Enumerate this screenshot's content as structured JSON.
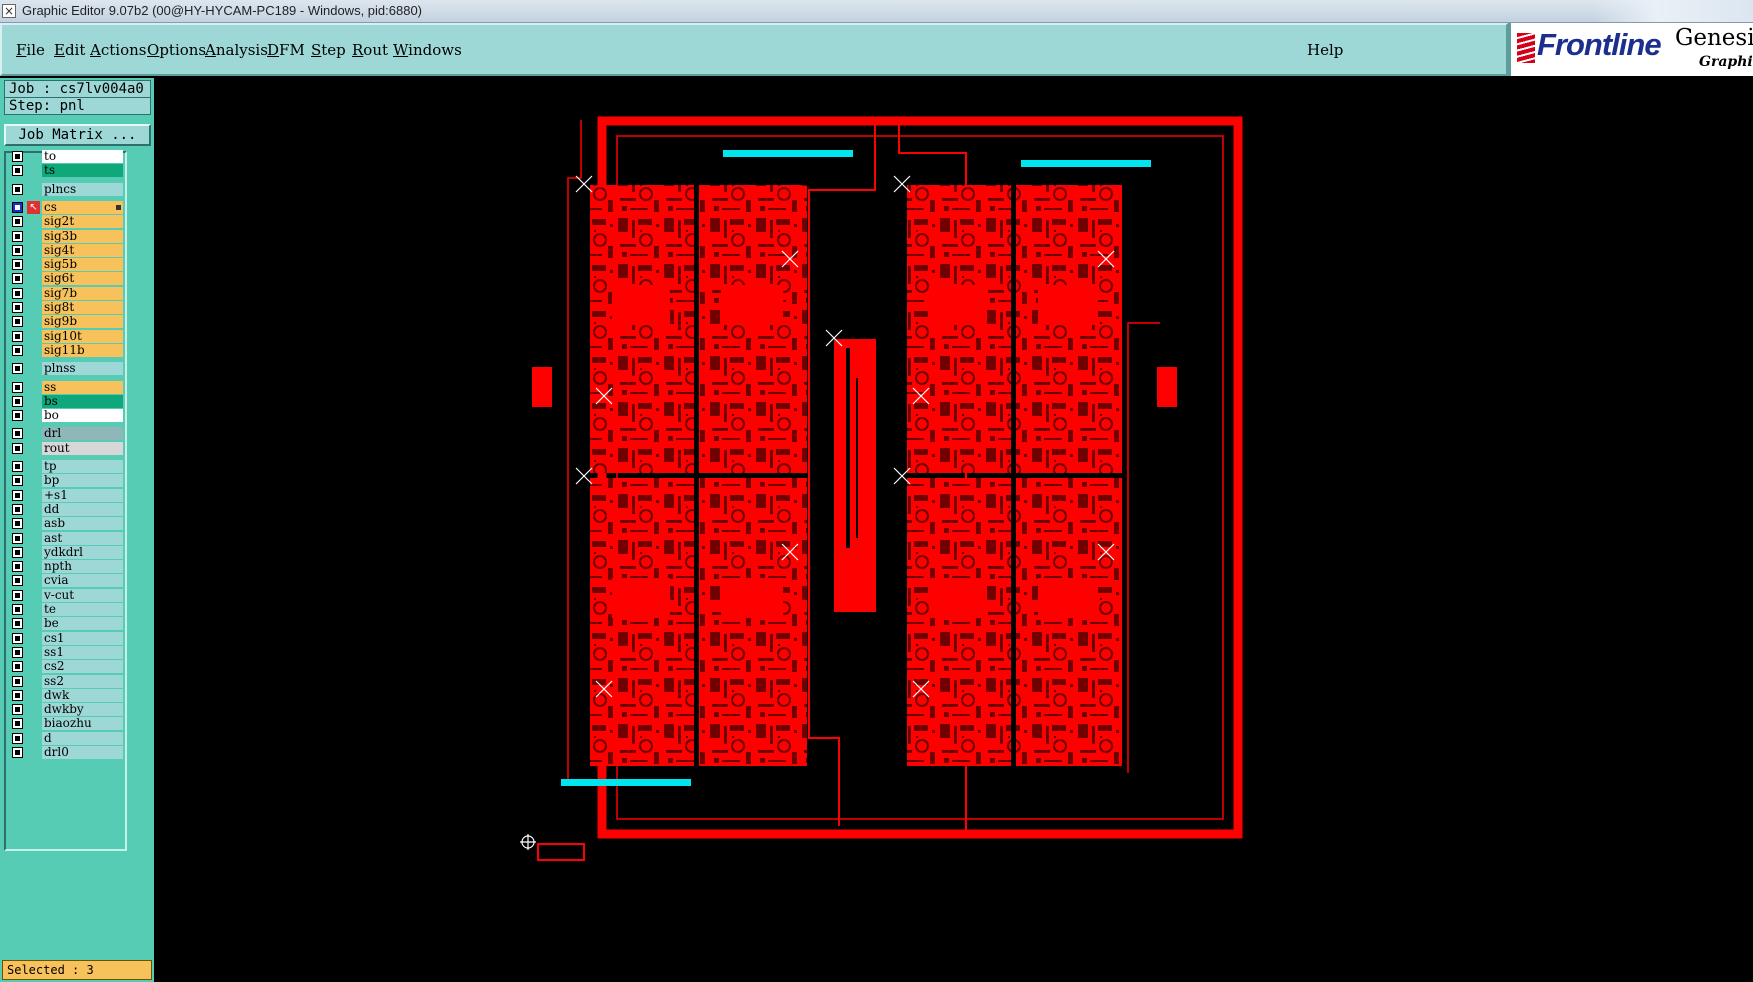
{
  "window": {
    "title": "Graphic Editor 9.07b2 (00@HY-HYCAM-PC189 - Windows, pid:6880)"
  },
  "menubar": {
    "items": [
      {
        "label": "File",
        "underline": "F",
        "rest": "ile"
      },
      {
        "label": "Edit",
        "underline": "E",
        "rest": "dit"
      },
      {
        "label": "Actions",
        "underline": "A",
        "rest": "ctions"
      },
      {
        "label": "Options",
        "underline": "O",
        "rest": "ptions"
      },
      {
        "label": "Analysis",
        "underline": "A",
        "rest": "nalysis"
      },
      {
        "label": "DFM",
        "underline": "D",
        "rest": "FM"
      },
      {
        "label": "Step",
        "underline": "S",
        "rest": "tep"
      },
      {
        "label": "Rout",
        "underline": "R",
        "rest": "out"
      },
      {
        "label": "Windows",
        "underline": "W",
        "rest": "indows"
      }
    ],
    "help": "Help"
  },
  "logo": {
    "brand": "Frontline",
    "product": "Genesis",
    "subtitle": "Graphic"
  },
  "job": {
    "job_line": "Job : cs7lv004a0",
    "step_line": "Step: pnl",
    "matrix_button": "Job Matrix ..."
  },
  "colors": {
    "board": "#ff0000",
    "highlight": "#00e5ee",
    "panel": "#56ccb4",
    "menu": "#9dd7d6"
  },
  "layers": [
    {
      "name": "to",
      "bg": "#ffffff",
      "group": 0
    },
    {
      "name": "ts",
      "bg": "#10a87a",
      "group": 0
    },
    {
      "name": "plncs",
      "bg": "#9dd7d6",
      "group": 1
    },
    {
      "name": "cs",
      "bg": "#f7c25b",
      "group": 2,
      "active": true
    },
    {
      "name": "sig2t",
      "bg": "#f7c25b",
      "group": 2
    },
    {
      "name": "sig3b",
      "bg": "#f7c25b",
      "group": 2
    },
    {
      "name": "sig4t",
      "bg": "#f7c25b",
      "group": 2
    },
    {
      "name": "sig5b",
      "bg": "#f7c25b",
      "group": 2
    },
    {
      "name": "sig6t",
      "bg": "#f7c25b",
      "group": 2
    },
    {
      "name": "sig7b",
      "bg": "#f7c25b",
      "group": 2
    },
    {
      "name": "sig8t",
      "bg": "#f7c25b",
      "group": 2
    },
    {
      "name": "sig9b",
      "bg": "#f7c25b",
      "group": 2
    },
    {
      "name": "sig10t",
      "bg": "#f7c25b",
      "group": 2
    },
    {
      "name": "sig11b",
      "bg": "#f7c25b",
      "group": 2
    },
    {
      "name": "plnss",
      "bg": "#9dd7d6",
      "group": 3
    },
    {
      "name": "ss",
      "bg": "#f7c25b",
      "group": 4
    },
    {
      "name": "bs",
      "bg": "#10a87a",
      "group": 4
    },
    {
      "name": "bo",
      "bg": "#ffffff",
      "group": 4
    },
    {
      "name": "drl",
      "bg": "#8fb6b8",
      "group": 5
    },
    {
      "name": "rout",
      "bg": "#d7d7d7",
      "group": 5
    },
    {
      "name": "tp",
      "bg": "#9dd7d6",
      "group": 6
    },
    {
      "name": "bp",
      "bg": "#9dd7d6",
      "group": 6
    },
    {
      "name": "+s1",
      "bg": "#9dd7d6",
      "group": 6
    },
    {
      "name": "dd",
      "bg": "#9dd7d6",
      "group": 6
    },
    {
      "name": "asb",
      "bg": "#9dd7d6",
      "group": 6
    },
    {
      "name": "ast",
      "bg": "#9dd7d6",
      "group": 6
    },
    {
      "name": "ydkdrl",
      "bg": "#9dd7d6",
      "group": 6
    },
    {
      "name": "npth",
      "bg": "#9dd7d6",
      "group": 6
    },
    {
      "name": "cvia",
      "bg": "#9dd7d6",
      "group": 6
    },
    {
      "name": "v-cut",
      "bg": "#9dd7d6",
      "group": 6
    },
    {
      "name": "te",
      "bg": "#9dd7d6",
      "group": 6
    },
    {
      "name": "be",
      "bg": "#9dd7d6",
      "group": 6
    },
    {
      "name": "cs1",
      "bg": "#9dd7d6",
      "group": 6
    },
    {
      "name": "ss1",
      "bg": "#9dd7d6",
      "group": 6
    },
    {
      "name": "cs2",
      "bg": "#9dd7d6",
      "group": 6
    },
    {
      "name": "ss2",
      "bg": "#9dd7d6",
      "group": 6
    },
    {
      "name": "dwk",
      "bg": "#9dd7d6",
      "group": 6
    },
    {
      "name": "dwkby",
      "bg": "#9dd7d6",
      "group": 6
    },
    {
      "name": "biaozhu",
      "bg": "#9dd7d6",
      "group": 6
    },
    {
      "name": "d",
      "bg": "#9dd7d6",
      "group": 6
    },
    {
      "name": "drl0",
      "bg": "#9dd7d6",
      "group": 6
    }
  ],
  "status": {
    "selected": "Selected : 3"
  }
}
